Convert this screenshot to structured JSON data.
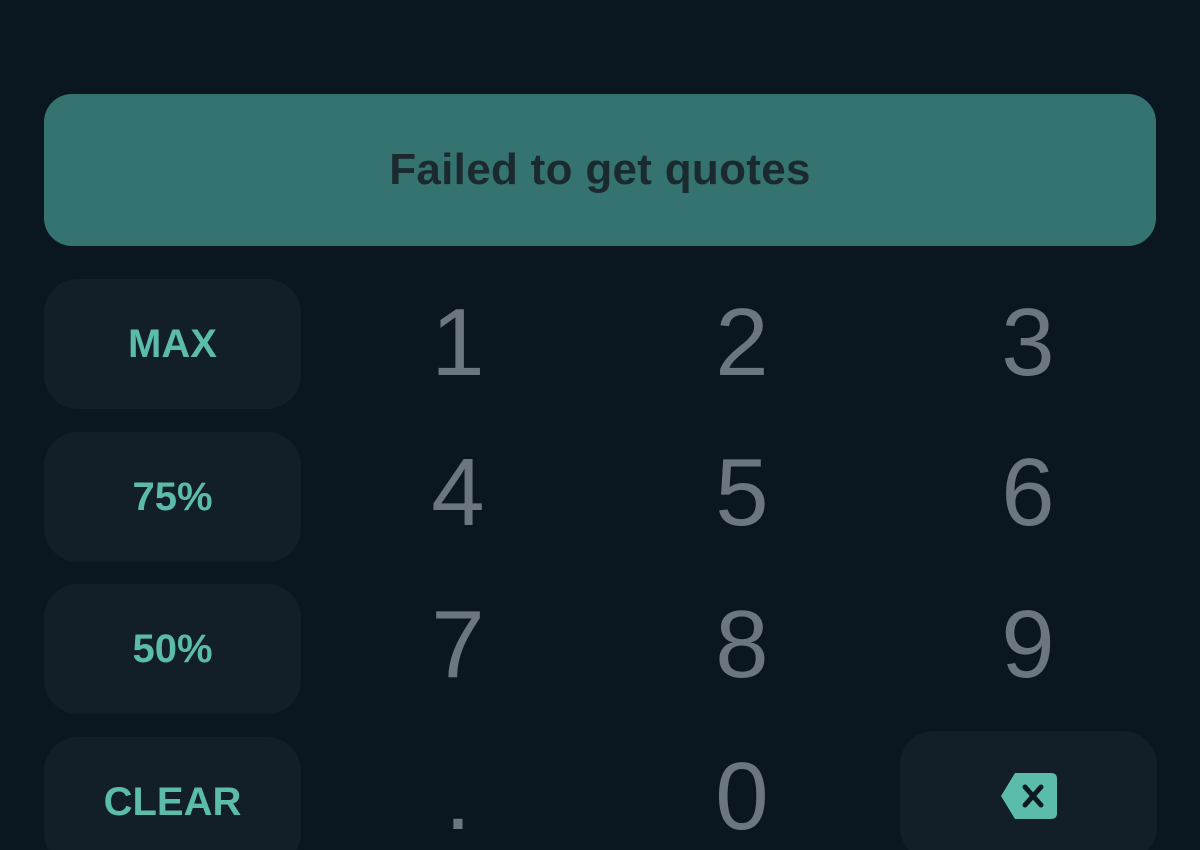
{
  "banner": {
    "text": "Failed to get quotes"
  },
  "quick_amounts": [
    {
      "label": "MAX"
    },
    {
      "label": "75%"
    },
    {
      "label": "50%"
    },
    {
      "label": "CLEAR"
    }
  ],
  "keypad": {
    "keys": [
      "1",
      "2",
      "3",
      "4",
      "5",
      "6",
      "7",
      "8",
      "9",
      ".",
      "0"
    ]
  },
  "backspace": {
    "icon": "backspace-icon"
  },
  "colors": {
    "background": "#0b1720",
    "banner": "#357371",
    "accent": "#5cbcab",
    "button_bg": "#121f28",
    "digit": "#6b7680"
  }
}
